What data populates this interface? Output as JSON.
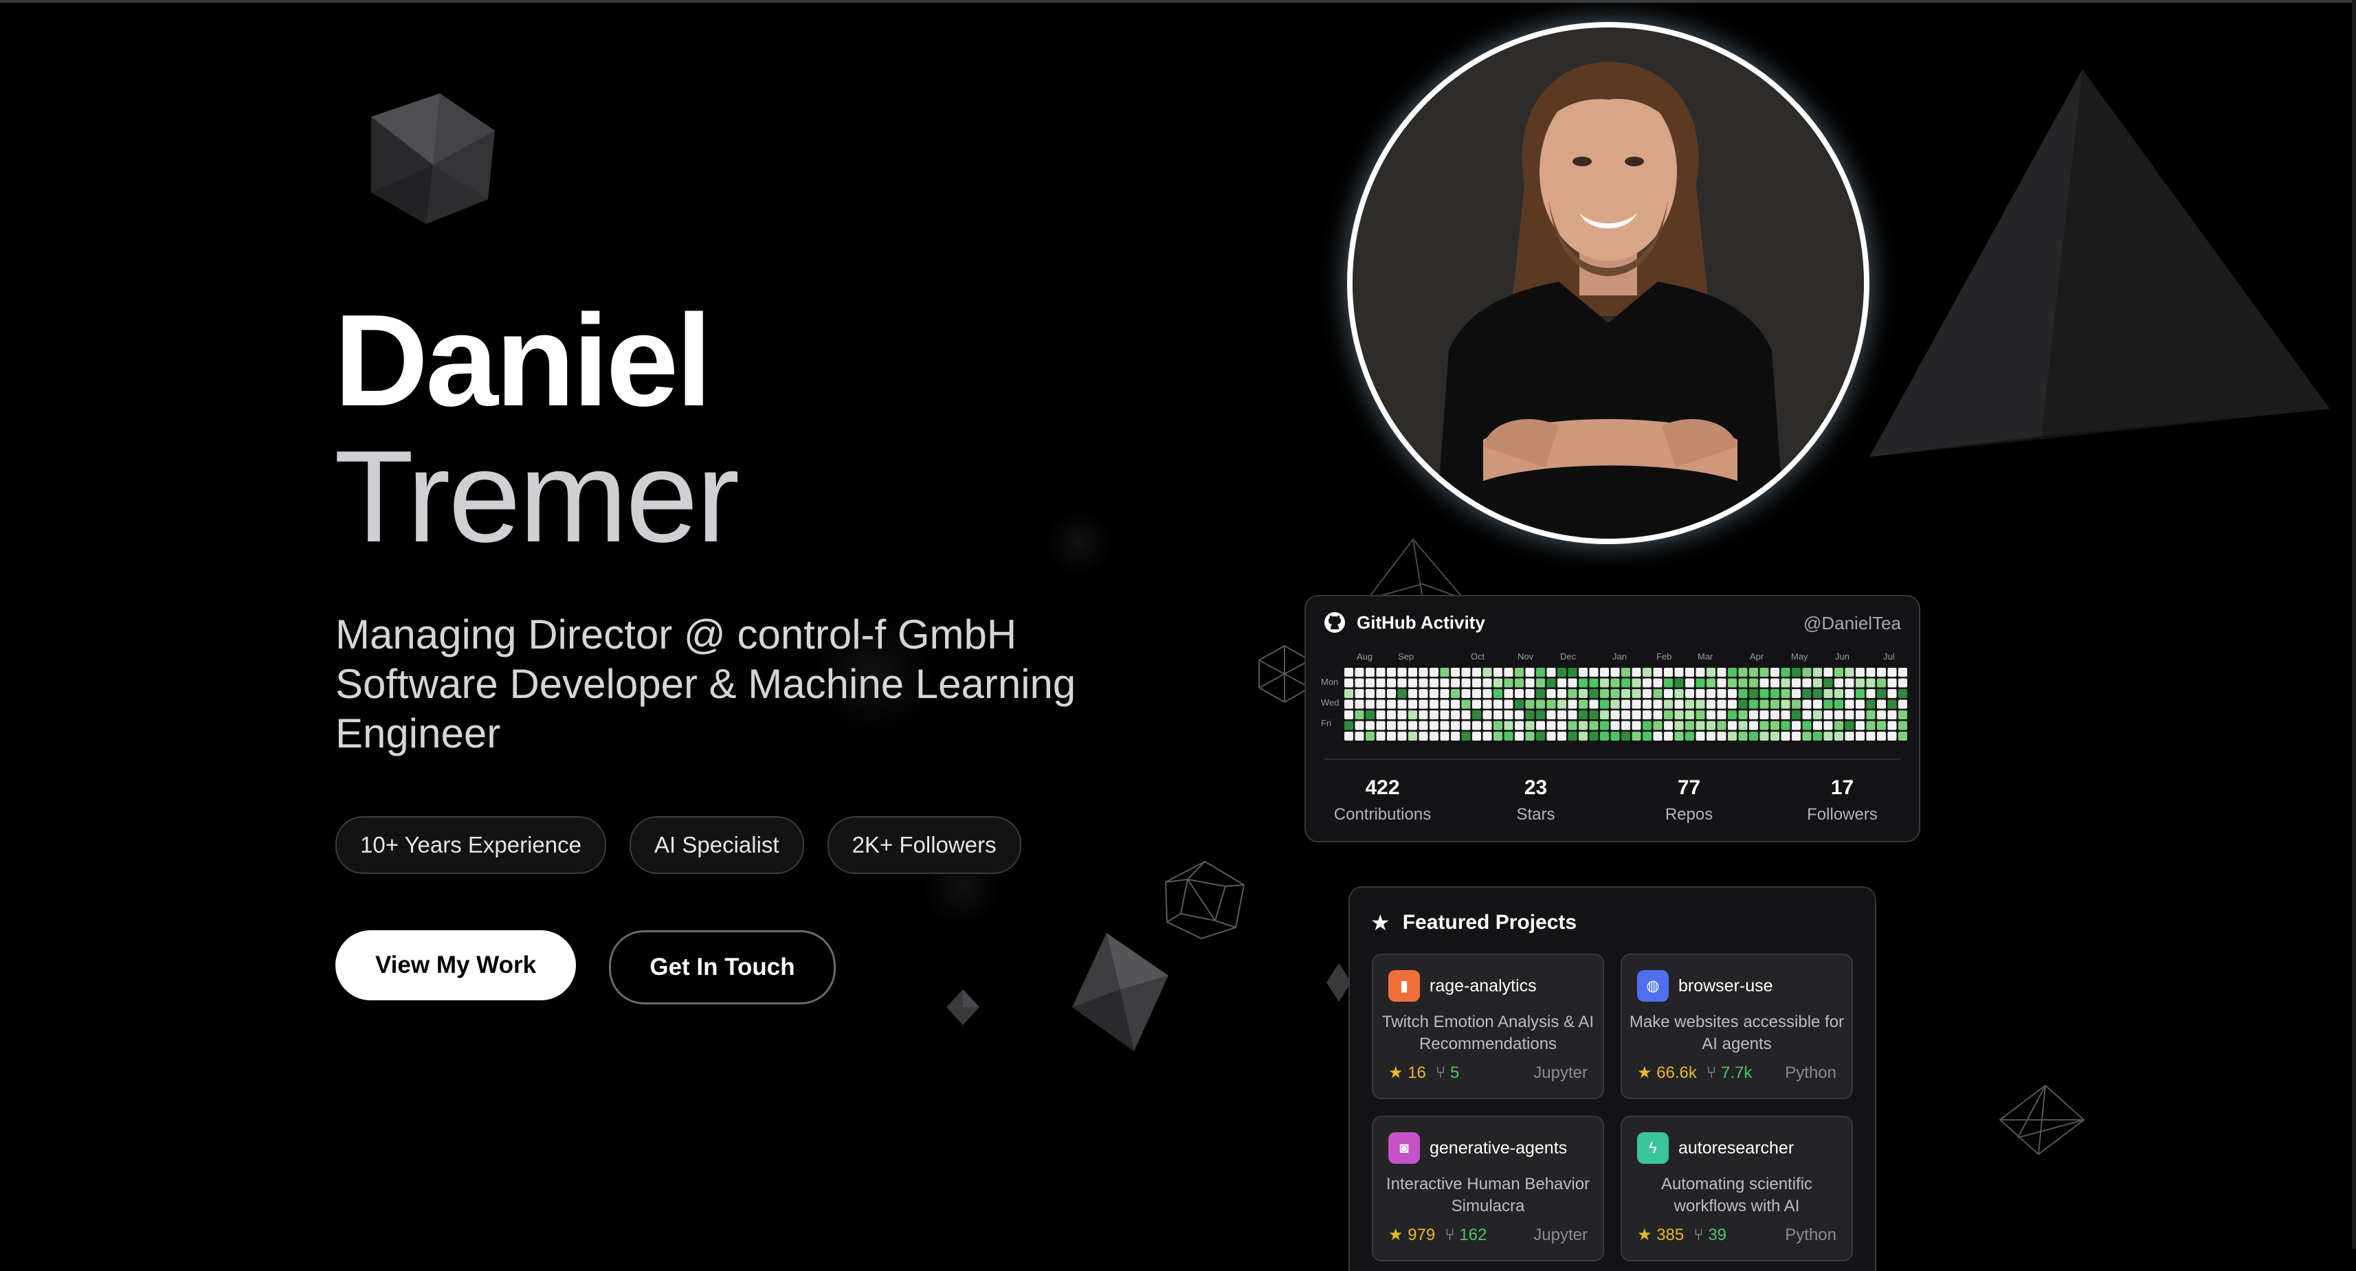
{
  "hero": {
    "first_name": "Daniel",
    "last_name": "Tremer",
    "subtitle_line1": "Managing Director @ control-f GmbH",
    "subtitle_line2": "Software Developer & Machine Learning Engineer",
    "chips": [
      "10+ Years Experience",
      "AI Specialist",
      "2K+ Followers"
    ],
    "primary_button": "View My Work",
    "secondary_button": "Get In Touch"
  },
  "github": {
    "title": "GitHub Activity",
    "username": "@DanielTea",
    "months": [
      "Aug",
      "Sep",
      "Oct",
      "Nov",
      "Dec",
      "Jan",
      "Feb",
      "Mar",
      "Apr",
      "May",
      "Jun",
      "Jul"
    ],
    "days": [
      "Mon",
      "Wed",
      "Fri"
    ],
    "stats": [
      {
        "value": "422",
        "label": "Contributions"
      },
      {
        "value": "23",
        "label": "Stars"
      },
      {
        "value": "77",
        "label": "Repos"
      },
      {
        "value": "17",
        "label": "Followers"
      }
    ]
  },
  "featured": {
    "title": "Featured Projects",
    "projects": [
      {
        "name": "rage-analytics",
        "description": "Twitch Emotion Analysis & AI Recommendations",
        "stars": "16",
        "forks": "5",
        "language": "Jupyter",
        "icon": "chart-icon",
        "icon_color": "#f0703a"
      },
      {
        "name": "browser-use",
        "description": "Make websites accessible for AI agents",
        "stars": "66.6k",
        "forks": "7.7k",
        "language": "Python",
        "icon": "globe-icon",
        "icon_color": "#4f6ff0"
      },
      {
        "name": "generative-agents",
        "description": "Interactive Human Behavior Simulacra",
        "stars": "979",
        "forks": "162",
        "language": "Jupyter",
        "icon": "robot-icon",
        "icon_color": "#c552c9"
      },
      {
        "name": "autoresearcher",
        "description": "Automating scientific workflows with AI",
        "stars": "385",
        "forks": "39",
        "language": "Python",
        "icon": "bolt-icon",
        "icon_color": "#3cc49a"
      }
    ]
  },
  "colors": {
    "accent_green": "#4ec464",
    "star_yellow": "#e8b923",
    "background": "#000000"
  }
}
